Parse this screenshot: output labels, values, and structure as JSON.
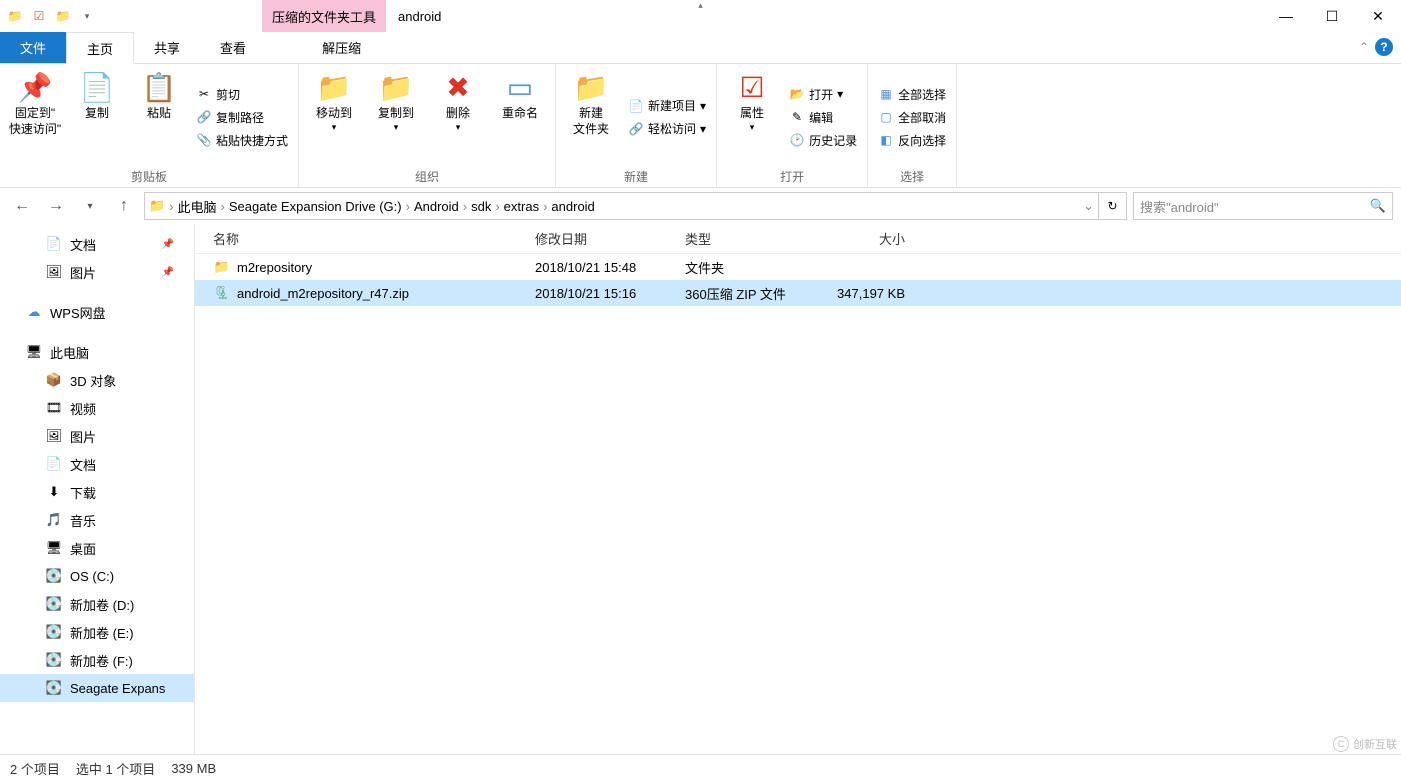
{
  "title": "android",
  "context_tab": "压缩的文件夹工具",
  "tabs": {
    "file": "文件",
    "home": "主页",
    "share": "共享",
    "view": "查看",
    "extract": "解压缩"
  },
  "ribbon": {
    "clipboard": {
      "label": "剪贴板",
      "pin": "固定到\"\n快速访问\"",
      "copy": "复制",
      "paste": "粘贴",
      "cut": "剪切",
      "copypath": "复制路径",
      "paste_shortcut": "粘贴快捷方式"
    },
    "organize": {
      "label": "组织",
      "moveto": "移动到",
      "copyto": "复制到",
      "delete": "删除",
      "rename": "重命名"
    },
    "new": {
      "label": "新建",
      "newfolder": "新建\n文件夹",
      "newitem": "新建项目",
      "easyaccess": "轻松访问"
    },
    "open": {
      "label": "打开",
      "properties": "属性",
      "open": "打开",
      "edit": "编辑",
      "history": "历史记录"
    },
    "select": {
      "label": "选择",
      "selectall": "全部选择",
      "selectnone": "全部取消",
      "invert": "反向选择"
    }
  },
  "breadcrumb": [
    "此电脑",
    "Seagate Expansion Drive (G:)",
    "Android",
    "sdk",
    "extras",
    "android"
  ],
  "search_placeholder": "搜索\"android\"",
  "columns": {
    "name": "名称",
    "date": "修改日期",
    "type": "类型",
    "size": "大小"
  },
  "files": [
    {
      "icon": "folder",
      "name": "m2repository",
      "date": "2018/10/21 15:48",
      "type": "文件夹",
      "size": "",
      "selected": false
    },
    {
      "icon": "zip",
      "name": "android_m2repository_r47.zip",
      "date": "2018/10/21 15:16",
      "type": "360压缩 ZIP 文件",
      "size": "347,197 KB",
      "selected": true
    }
  ],
  "sidebar": {
    "quick": [
      {
        "label": "文档",
        "icon": "doc",
        "pinned": true
      },
      {
        "label": "图片",
        "icon": "pic",
        "pinned": true
      }
    ],
    "wps": "WPS网盘",
    "thispc": "此电脑",
    "thispc_items": [
      {
        "label": "3D 对象",
        "icon": "3d"
      },
      {
        "label": "视频",
        "icon": "video"
      },
      {
        "label": "图片",
        "icon": "pic"
      },
      {
        "label": "文档",
        "icon": "doc"
      },
      {
        "label": "下载",
        "icon": "dl"
      },
      {
        "label": "音乐",
        "icon": "music"
      },
      {
        "label": "桌面",
        "icon": "desktop"
      },
      {
        "label": "OS (C:)",
        "icon": "drive"
      },
      {
        "label": "新加卷 (D:)",
        "icon": "drive"
      },
      {
        "label": "新加卷 (E:)",
        "icon": "drive"
      },
      {
        "label": "新加卷 (F:)",
        "icon": "drive"
      },
      {
        "label": "Seagate Expans",
        "icon": "drive",
        "selected": true
      }
    ]
  },
  "status": {
    "count": "2 个项目",
    "selected": "选中 1 个项目",
    "size": "339 MB"
  },
  "watermark": "创新互联"
}
